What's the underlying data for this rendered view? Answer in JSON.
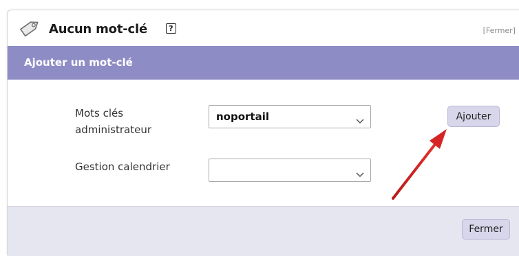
{
  "dialog": {
    "title": "Aucun mot-clé",
    "help_glyph": "?",
    "close_link": "[Fermer]",
    "tag_icon": "tag-icon",
    "help_icon": "help-icon"
  },
  "section": {
    "title": "Ajouter un mot-clé"
  },
  "form": {
    "admin_keywords": {
      "label_line1": "Mots clés",
      "label_line2": "administrateur",
      "selected": "noportail"
    },
    "calendar": {
      "label": "Gestion calendrier",
      "selected": ""
    },
    "add_button": "Ajouter"
  },
  "footer": {
    "close_button": "Fermer"
  },
  "colors": {
    "header_bg": "#8e8cc4",
    "footer_bg": "#e6e6f1",
    "button_bg": "#d8d6ea",
    "annotation_arrow": "#d62424"
  }
}
